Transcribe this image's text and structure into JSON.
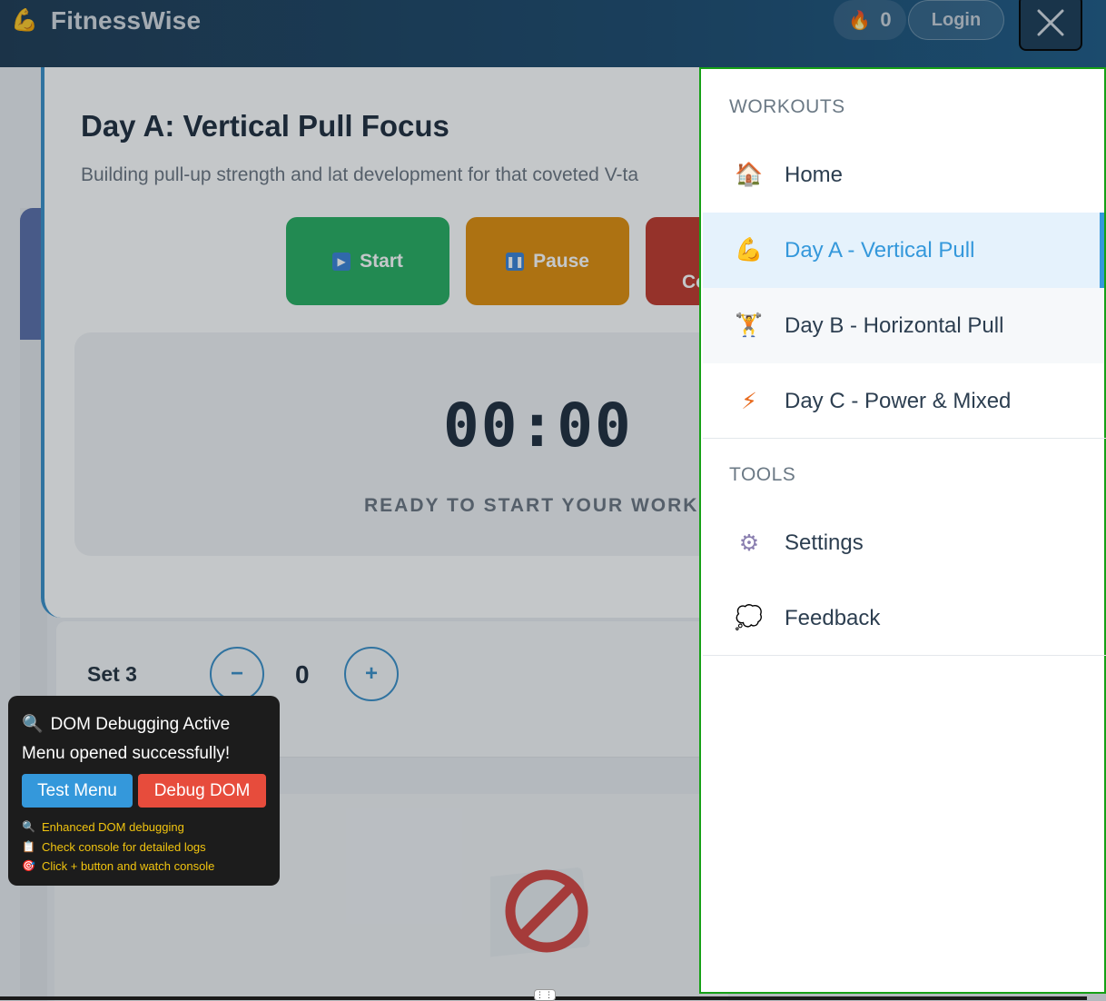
{
  "header": {
    "brand_icon": "flexed-biceps-icon",
    "brand_name": "FitnessWise",
    "streak_icon": "fire-icon",
    "streak_count": "0",
    "login_label": "Login",
    "close_icon": "close-icon"
  },
  "workout": {
    "title": "Day A: Vertical Pull Focus",
    "subtitle": "Building pull-up strength and lat development for that coveted V-ta",
    "controls": {
      "start_label": "Start",
      "pause_label": "Pause",
      "complete_label": "Co"
    },
    "timer": "00:00",
    "timer_status": "READY TO START YOUR WORKO"
  },
  "set": {
    "label": "Set 3",
    "minus": "−",
    "plus": "+",
    "count": "0"
  },
  "debug_panel": {
    "title": "DOM Debugging Active",
    "message": "Menu opened successfully!",
    "test_button": "Test Menu",
    "debug_button": "Debug DOM",
    "notes": [
      {
        "icon": "magnifier-icon",
        "text": "Enhanced DOM debugging"
      },
      {
        "icon": "clipboard-icon",
        "text": "Check console for detailed logs"
      },
      {
        "icon": "target-icon",
        "text": "Click + button and watch console"
      }
    ]
  },
  "menu": {
    "sections": [
      {
        "title": "WORKOUTS",
        "items": [
          {
            "icon": "house-icon",
            "label": "Home",
            "state": "normal"
          },
          {
            "icon": "flexed-biceps-icon",
            "label": "Day A - Vertical Pull",
            "state": "active"
          },
          {
            "icon": "weightlifter-icon",
            "label": "Day B - Horizontal Pull",
            "state": "hover"
          },
          {
            "icon": "lightning-icon",
            "label": "Day C - Power & Mixed",
            "state": "normal"
          }
        ]
      },
      {
        "title": "TOOLS",
        "items": [
          {
            "icon": "gear-icon",
            "label": "Settings",
            "state": "normal"
          },
          {
            "icon": "speech-bubble-icon",
            "label": "Feedback",
            "state": "normal"
          }
        ]
      }
    ]
  },
  "colors": {
    "accent": "#3498db",
    "start": "#27ae60",
    "pause": "#e08e0b",
    "complete": "#c0392b",
    "menu_border": "#16a016"
  }
}
